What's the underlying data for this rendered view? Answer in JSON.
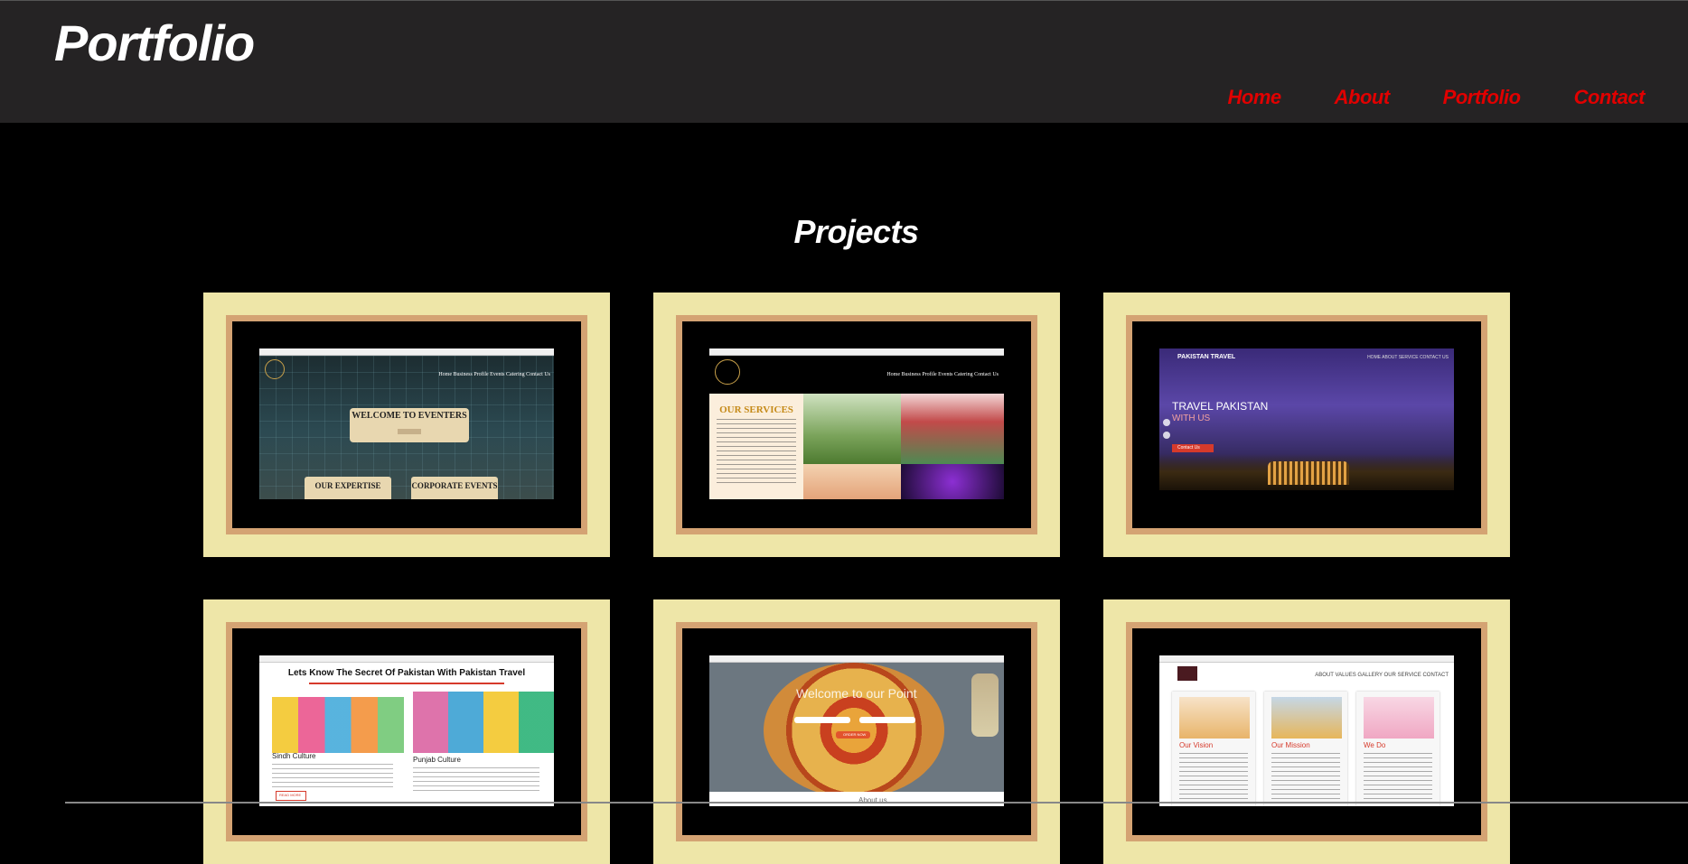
{
  "header": {
    "brand": "Portfolio",
    "nav": [
      "Home",
      "About",
      "Portfolio",
      "Contact"
    ]
  },
  "section": {
    "title": "Projects"
  },
  "colors": {
    "header_bg": "#252324",
    "nav_link": "#e10000",
    "card_bg": "#eee6a8",
    "frame": "#d4a373"
  },
  "projects": [
    {
      "menu": "Home    Business Profile    Events    Catering    Contact Us",
      "hero": "WELCOME TO EVENTERS",
      "box1": "OUR EXPERTISE",
      "box2": "CORPORATE EVENTS"
    },
    {
      "menu": "Home    Business Profile    Events    Catering    Contact Us",
      "heading": "OUR SERVICES"
    },
    {
      "brand": "PAKISTAN TRAVEL",
      "menu": "HOME    ABOUT    SERVICE    CONTACT US",
      "title": "TRAVEL PAKISTAN",
      "title2": "WITH US",
      "cta": "Contact Us"
    },
    {
      "heading": "Lets Know The Secret Of Pakistan With Pakistan Travel",
      "caption1": "Sindh Culture",
      "caption2": "Punjab Culture",
      "more": "READ MORE"
    },
    {
      "title": "Welcome to our Point",
      "cta": "ORDER NOW",
      "about": "About us"
    },
    {
      "menu": "ABOUT    VALUES    GALLERY    OUR SERVICE    CONTACT",
      "columns": [
        "Our Vision",
        "Our Mission",
        "We Do"
      ]
    }
  ]
}
